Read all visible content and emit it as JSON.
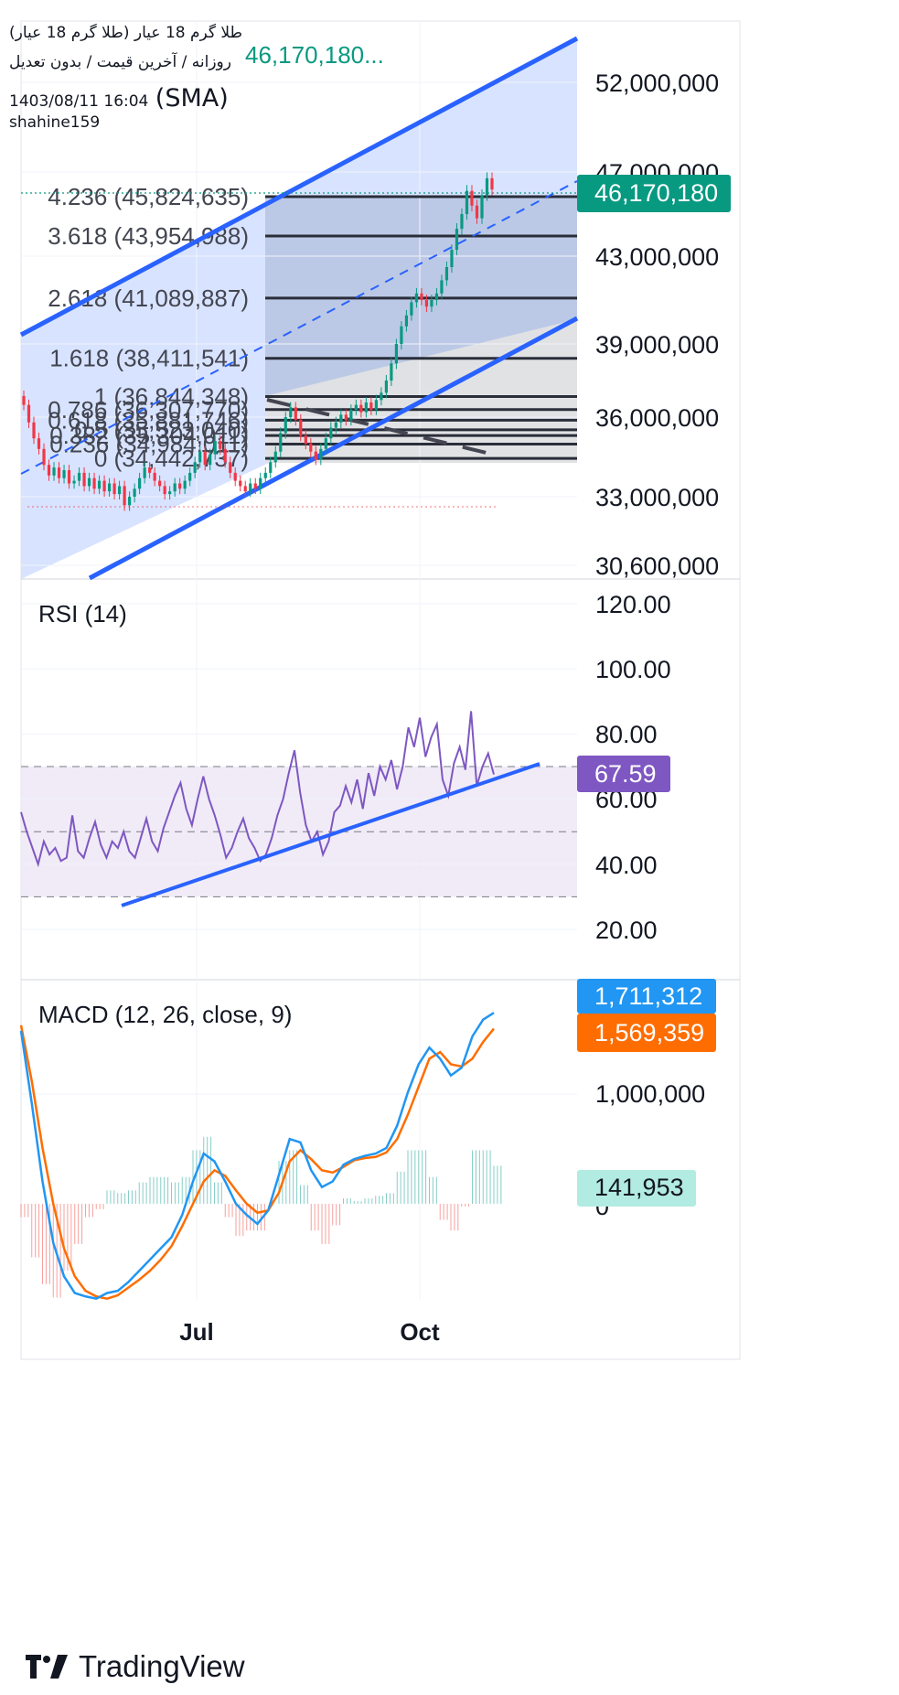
{
  "header": {
    "title": "طلا گرم 18 عیار (طلا گرم 18 عیار)",
    "subtitle": "روزانه / آخرین قیمت / بدون تعدیل",
    "datetime": "1403/08/11 16:04",
    "volume_label": "(SMA)",
    "user": "shahine159",
    "last_price": "46,170,180..."
  },
  "branding": {
    "logo_text": "TradingView"
  },
  "colors": {
    "up": "#089981",
    "down": "#f23645",
    "channel": "#2962ff",
    "rsi": "#7e57c2",
    "macd": "#2196f3",
    "signal": "#ff6d00",
    "fib": "#2a2e39",
    "hist_up": "#26a69a",
    "hist_down": "#ef5350"
  },
  "chart_data": [
    {
      "type": "candlestick",
      "panel": "price",
      "y_ticks": [
        "52,000,000",
        "47,000,000",
        "43,000,000",
        "39,000,000",
        "36,000,000",
        "33,000,000",
        "30,600,000"
      ],
      "y_tick_values": [
        52000000,
        47000000,
        43000000,
        39000000,
        36000000,
        33000000,
        30600000
      ],
      "x_ticks": [
        "Jul",
        "Oct"
      ],
      "last_price_label": "46,170,180",
      "last_price": 46170180,
      "fib_levels": [
        {
          "label": "4.236 (45,824,635)",
          "value": 45824635
        },
        {
          "label": "3.618 (43,954,988)",
          "value": 43954988
        },
        {
          "label": "2.618 (41,089,887)",
          "value": 41089887
        },
        {
          "label": "1.618 (38,411,541)",
          "value": 38411541
        },
        {
          "label": "1 (36,844,348)",
          "value": 36844348
        },
        {
          "label": "0.786 (36,307,770)",
          "value": 36307770
        },
        {
          "label": "0.618 (35,881,746)",
          "value": 35881746
        },
        {
          "label": "0.5 (35,523,040)",
          "value": 35523040
        },
        {
          "label": "0.382 (35,304,011)",
          "value": 35304011
        },
        {
          "label": "0.236 (34,984,011)",
          "value": 34984011
        },
        {
          "label": "0 (34,442,737)",
          "value": 34442737
        }
      ],
      "closes": [
        36500000,
        35800000,
        35200000,
        34800000,
        34200000,
        33800000,
        34100000,
        33700000,
        34000000,
        33500000,
        33600000,
        33900000,
        33400000,
        33700000,
        33300000,
        33600000,
        33200000,
        33500000,
        33100000,
        33400000,
        32700000,
        33000000,
        33300000,
        33700000,
        34100000,
        33900000,
        33600000,
        33400000,
        33100000,
        33200000,
        33500000,
        33300000,
        33600000,
        33900000,
        34300000,
        34700000,
        34200000,
        34600000,
        35100000,
        34800000,
        34300000,
        33900000,
        33600000,
        33400000,
        33200000,
        33500000,
        33300000,
        33700000,
        33900000,
        34300000,
        34700000,
        35400000,
        36000000,
        36400000,
        35900000,
        35300000,
        35000000,
        34700000,
        34400000,
        34800000,
        35200000,
        35600000,
        35800000,
        36100000,
        35900000,
        36300000,
        36500000,
        36200000,
        36600000,
        36300000,
        36700000,
        37000000,
        37500000,
        38200000,
        39000000,
        39800000,
        40300000,
        40900000,
        41300000,
        41000000,
        40700000,
        41000000,
        41300000,
        41900000,
        42500000,
        43300000,
        44300000,
        45000000,
        46100000,
        45400000,
        44800000,
        45900000,
        46700000,
        46170180
      ],
      "rsi": {
        "label": "RSI (14)",
        "value_label": "67.59",
        "value": 67.59,
        "y_ticks": [
          "120.00",
          "100.00",
          "80.00",
          "60.00",
          "40.00",
          "20.00"
        ],
        "bands": [
          70,
          50,
          30
        ],
        "values": [
          56,
          50,
          45,
          40,
          47,
          43,
          45,
          41,
          42,
          55,
          44,
          42,
          48,
          53,
          46,
          42,
          47,
          45,
          50,
          44,
          42,
          48,
          54,
          47,
          44,
          51,
          56,
          61,
          65,
          57,
          52,
          60,
          67,
          60,
          55,
          49,
          42,
          45,
          50,
          54,
          48,
          45,
          41,
          43,
          48,
          55,
          60,
          68,
          75,
          62,
          52,
          47,
          50,
          43,
          47,
          56,
          58,
          64,
          59,
          66,
          57,
          68,
          61,
          70,
          66,
          72,
          63,
          70,
          82,
          76,
          85,
          73,
          79,
          83,
          66,
          61,
          71,
          76,
          69,
          87,
          64,
          70,
          74,
          67.59
        ]
      },
      "macd": {
        "label": "MACD (12, 26, close, 9)",
        "macd_label": "1,711,312",
        "signal_label": "1,569,359",
        "hist_label": "141,953",
        "macd_value": 1711312,
        "signal_value": 1569359,
        "hist_value": 141953,
        "y_ticks": [
          "1,000,000",
          "0"
        ],
        "macd": [
          1550000,
          900000,
          200000,
          -350000,
          -650000,
          -800000,
          -830000,
          -850000,
          -800000,
          -780000,
          -700000,
          -600000,
          -500000,
          -400000,
          -300000,
          -100000,
          200000,
          450000,
          380000,
          200000,
          0,
          -100000,
          -180000,
          -60000,
          260000,
          580000,
          550000,
          300000,
          150000,
          200000,
          350000,
          400000,
          430000,
          450000,
          500000,
          700000,
          1000000,
          1250000,
          1400000,
          1300000,
          1150000,
          1220000,
          1500000,
          1650000,
          1711312
        ],
        "signal": [
          1600000,
          1100000,
          500000,
          0,
          -400000,
          -650000,
          -780000,
          -830000,
          -850000,
          -820000,
          -750000,
          -680000,
          -600000,
          -500000,
          -380000,
          -200000,
          0,
          200000,
          300000,
          250000,
          120000,
          0,
          -80000,
          -60000,
          100000,
          380000,
          480000,
          400000,
          300000,
          280000,
          330000,
          390000,
          410000,
          420000,
          460000,
          580000,
          800000,
          1050000,
          1300000,
          1360000,
          1250000,
          1230000,
          1300000,
          1450000,
          1569359
        ]
      }
    }
  ]
}
